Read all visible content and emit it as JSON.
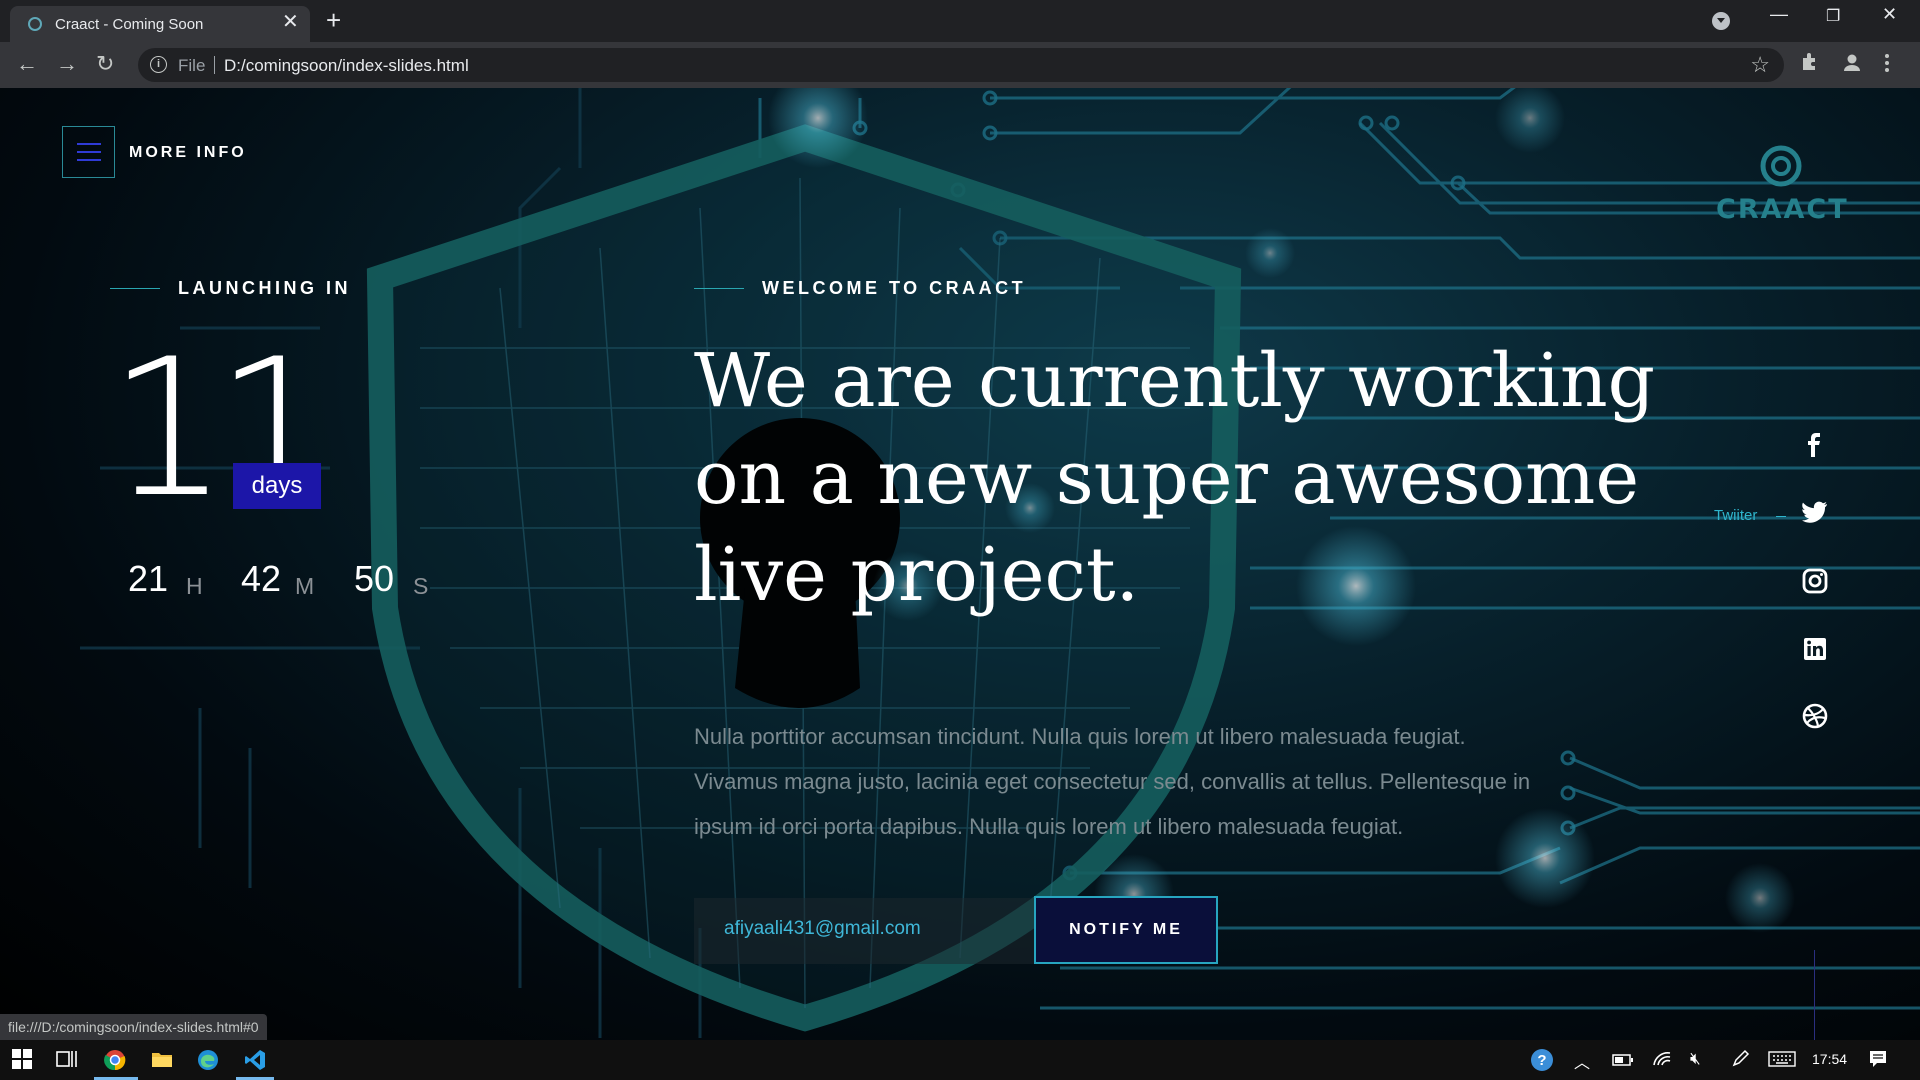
{
  "browser": {
    "tab_title": "Craact - Coming Soon",
    "tab_close": "✕",
    "new_tab": "+",
    "omnibox_scheme": "File",
    "omnibox_url": "D:/comingsoon/index-slides.html",
    "status_url": "file:///D:/comingsoon/index-slides.html#0"
  },
  "header": {
    "menu_label": "MORE INFO",
    "logo_text": "CRAACT"
  },
  "countdown": {
    "section_label": "LAUNCHING IN",
    "days": "11",
    "days_label": "days",
    "hours": "21",
    "hours_unit": "H",
    "minutes": "42",
    "minutes_unit": "M",
    "seconds": "50",
    "seconds_unit": "S"
  },
  "hero": {
    "section_label": "WELCOME TO CRAACT",
    "headline_line1": "We are currently working",
    "headline_line2": "on a new super awesome",
    "headline_line3": "live project.",
    "para_line1": "Nulla porttitor accumsan tincidunt. Nulla quis lorem ut libero malesuada feugiat.",
    "para_line2": "Vivamus magna justo, lacinia eget consectetur sed, convallis at tellus. Pellentesque in",
    "para_line3": "ipsum id orci porta dapibus. Nulla quis lorem ut libero malesuada feugiat."
  },
  "subscribe": {
    "email_value": "afiyaali431@gmail.com",
    "notify_label": "NOTIFY ME"
  },
  "social": {
    "active_label": "Twiiter",
    "items": [
      "facebook-icon",
      "twitter-icon",
      "instagram-icon",
      "linkedin-icon",
      "dribbble-icon"
    ]
  },
  "taskbar": {
    "clock": "17:54"
  },
  "colors": {
    "accent_teal": "#2aa6b0",
    "badge_blue": "#1c16a8",
    "email_text": "#3fb7d8"
  }
}
